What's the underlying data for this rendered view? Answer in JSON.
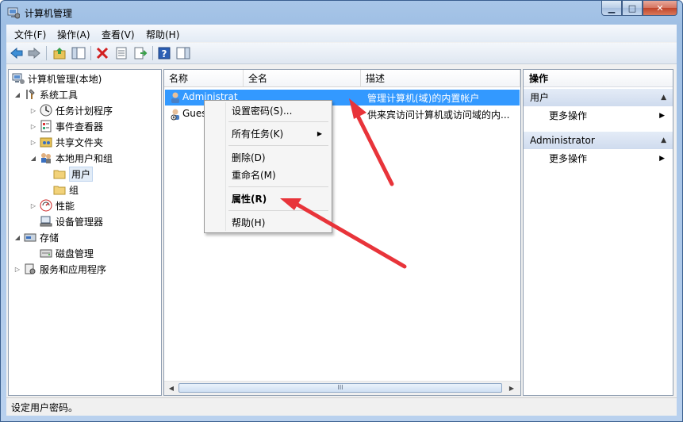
{
  "window": {
    "title": "计算机管理",
    "minimize": "▁",
    "maximize": "□",
    "close": "✕"
  },
  "menubar": [
    "文件(F)",
    "操作(A)",
    "查看(V)",
    "帮助(H)"
  ],
  "toolbar": [
    "back-icon",
    "forward-icon",
    "up-level-icon",
    "show-hide-tree-icon",
    "delete-icon",
    "properties-icon",
    "export-list-icon",
    "help-icon",
    "show-hide-action-icon"
  ],
  "tree": {
    "root": "计算机管理(本地)",
    "system_tools": "系统工具",
    "task_scheduler": "任务计划程序",
    "event_viewer": "事件查看器",
    "shared_folders": "共享文件夹",
    "local_users": "本地用户和组",
    "users": "用户",
    "groups": "组",
    "performance": "性能",
    "device_manager": "设备管理器",
    "storage": "存储",
    "disk_management": "磁盘管理",
    "services_apps": "服务和应用程序"
  },
  "list": {
    "columns": [
      "名称",
      "全名",
      "描述"
    ],
    "rows": [
      {
        "name": "Administrat",
        "fullname": "",
        "description": "管理计算机(域)的内置帐户"
      },
      {
        "name": "Gues",
        "fullname": "",
        "description": "供来宾访问计算机或访问域的内..."
      }
    ],
    "scroll_grip": "III"
  },
  "context_menu": {
    "set_password": "设置密码(S)...",
    "all_tasks": "所有任务(K)",
    "delete": "删除(D)",
    "rename": "重命名(M)",
    "properties": "属性(R)",
    "help": "帮助(H)"
  },
  "actions": {
    "title": "操作",
    "section1": "用户",
    "more1": "更多操作",
    "section2": "Administrator",
    "more2": "更多操作"
  },
  "status": "设定用户密码。",
  "colors": {
    "selection": "#3399ff",
    "annotation": "#e8343a"
  }
}
